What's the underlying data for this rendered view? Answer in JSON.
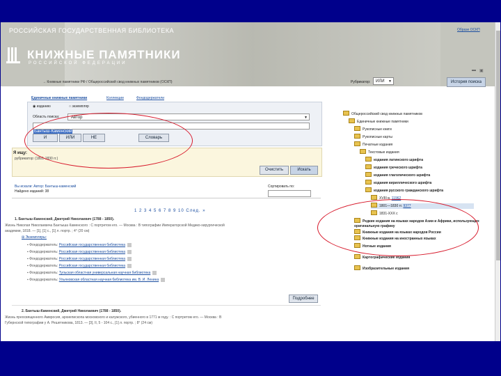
{
  "header": {
    "library_name": "РОССИЙСКАЯ ГОСУДАРСТВЕННАЯ БИБЛИОТЕКА",
    "about_link": "Об­разе ОСКП",
    "logo_title": "КНИЖНЫЕ ПАМЯТНИКИ",
    "logo_subtitle": "РОССИЙСКОЙ ФЕДЕРАЦИИ"
  },
  "breadcrumb": "→ Книжные памятники РФ / Общероссийский свод книжных памятников (ОСКП)",
  "tabs": [
    "Единичные книжные памятники",
    "Коллекции",
    "Фондодержатели"
  ],
  "search": {
    "radio_all": "изданию",
    "radio_copy": "экземпляр",
    "area_label": "Область поиска:",
    "area_value": "Автор",
    "query_value": "Бантыш-Каменский",
    "btn_and": "И",
    "btn_or": "ИЛИ",
    "btn_not": "НЕ",
    "btn_dict": "Словарь"
  },
  "query_box": {
    "label": "Я ищу:",
    "value": "рубрикатор: (1801-1830 гг.)",
    "btn_clear": "Очистить",
    "btn_search": "Искать"
  },
  "results": {
    "summary_line1": "Вы искали: Автор: Бантыш-каменский",
    "summary_line2": "Найдено изданий: 38",
    "sort_label": "Сортировать по:",
    "pagination": "1 2 3 4 5 6 7 8 9 10 След. »",
    "items": [
      {
        "title": "1. Бантыш-Каменский, Дмитрий Николаевич (1788 - 1850).",
        "desc1": "Жизнь Николая Николаевича Бантыша Каменского : С портретом его. — Москва : В типографии Императорской Медико-хирургической",
        "desc2": "академии, 1818. — [1], [1] с., [1] л. портр. ; 4° (20 см)",
        "copies_link": "Экземпляры:",
        "holders": [
          {
            "prefix": "Фондодержатель: ",
            "name": "Российская государственная библиотека"
          },
          {
            "prefix": "Фондодержатель: ",
            "name": "Российская государственная библиотека"
          },
          {
            "prefix": "Фондодержатель: ",
            "name": "Российская государственная библиотека"
          },
          {
            "prefix": "Фондодержатель: ",
            "name": "Российская государственная библиотека"
          },
          {
            "prefix": "Фондодержатель: ",
            "name": "Тульская областная универсальная научная библиотека"
          },
          {
            "prefix": "Фондодержатель: ",
            "name": "Ульяновская областная научная библиотека им. В. И. Ленина"
          }
        ],
        "detail_btn": "Подробнее"
      },
      {
        "title": "2. Бантыш-Каменский, Дмитрий Николаевич (1788 - 1850).",
        "desc1": "Жизнь преосвященного Амвросия, архиепископа московского и калужского, убиенного в 1771 м году. : С портретом его. — Москва : В",
        "desc2": "Губернской типографии у А. Решетникова, 1813. — [3], II, 5 - 104 с., [1] л. портр. ; 8° (24 см)"
      }
    ]
  },
  "rubricator": {
    "label": "Рубрикатор:",
    "select_value": "ИЛИ",
    "history_btn": "История поиска",
    "tree": [
      "Общероссийский свод книжных памятников",
      "Единичные книжные памятники",
      "Рукописные книги",
      "Рукописные карты",
      "Печатные издания",
      "Текстовые издания",
      "издания латинского шрифта",
      "издания греческого шрифта",
      "издания глаголического шрифта",
      "издания кириллического шрифта",
      "издания русского гражданского шрифта",
      "XVIII в.",
      "11962",
      "1801—1830 гг.",
      "9377",
      "1831-XXX с",
      "Редкие издания на языках народов Азии и Африки, использующих оригинальную графику",
      "Книжные издания на языках народов России",
      "Книжные издания на иностранных языках",
      "Нотные издания",
      "Картографические издания",
      "Изобразительные издания"
    ]
  }
}
